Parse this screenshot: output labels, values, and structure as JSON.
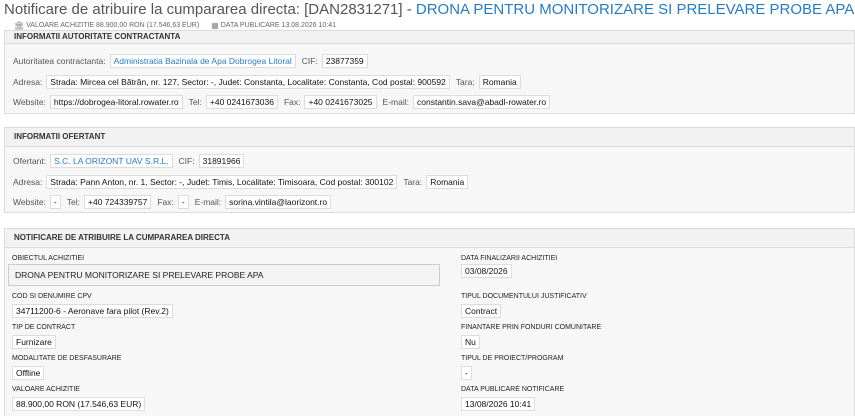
{
  "header": {
    "title_prefix": "Notificare de atribuire la cumpararea directa: [DAN2831271] - ",
    "title_link": "DRONA PENTRU MONITORIZARE SI PRELEVARE PROBE APA",
    "value_text": "VALOARE ACHIZITIE 88.900,00 RON (17.546,63 EUR)",
    "publish_text": "DATA PUBLICARE 13.08.2026 10:41",
    "value_icon": "bank-icon",
    "publish_icon": "calendar-icon"
  },
  "authority": {
    "heading": "INFORMATII AUTORITATE CONTRACTANTA",
    "name_label": "Autoritatea contractanta:",
    "name": "Administratia Bazinala de Apa Dobrogea Litoral",
    "cif_label": "CIF:",
    "cif": "23877359",
    "address_label": "Adresa:",
    "address": "Strada: Mircea cel Bătrân, nr. 127, Sector: -, Judet: Constanta, Localitate: Constanta, Cod postal: 900592",
    "country_label": "Tara:",
    "country": "Romania",
    "website_label": "Website:",
    "website": "https://dobrogea-litoral.rowater.ro",
    "tel_label": "Tel:",
    "tel": "+40 0241673036",
    "fax_label": "Fax:",
    "fax": "+40 0241673025",
    "email_label": "E-mail:",
    "email": "constantin.sava@abadl-rowater.ro"
  },
  "bidder": {
    "heading": "INFORMATII OFERTANT",
    "name_label": "Ofertant:",
    "name": "S.C. LA ORIZONT UAV S.R.L.",
    "cif_label": "CIF:",
    "cif": "31891966",
    "address_label": "Adresa:",
    "address": "Strada: Pann Anton, nr. 1, Sector: -, Judet: Timis, Localitate: Timisoara, Cod postal: 300102",
    "country_label": "Tara:",
    "country": "Romania",
    "website_label": "Website:",
    "website": "-",
    "tel_label": "Tel:",
    "tel": "+40 724339757",
    "fax_label": "Fax:",
    "fax": "-",
    "email_label": "E-mail:",
    "email": "sorina.vintila@laorizont.ro"
  },
  "notice": {
    "heading": "NOTIFICARE DE ATRIBUIRE LA CUMPARAREA DIRECTA",
    "object_label": "OBIECTUL ACHIZITIEI",
    "object": "DRONA PENTRU MONITORIZARE SI PRELEVARE PROBE APA",
    "end_date_label": "DATA FINALIZARII ACHIZITIEI",
    "end_date": "03/08/2026",
    "cpv_label": "COD SI DENUMIRE CPV",
    "cpv": "34711200-6 - Aeronave fara pilot (Rev.2)",
    "doc_type_label": "TIPUL DOCUMENTULUI JUSTIFICATIV",
    "doc_type": "Contract",
    "contract_type_label": "TIP DE CONTRACT",
    "contract_type": "Furnizare",
    "eu_funds_label": "FINANTARE PRIN FONDURI COMUNITARE",
    "eu_funds": "Nu",
    "mode_label": "MODALITATE DE DESFASURARE",
    "mode": "Offline",
    "project_type_label": "TIPUL DE PROIECT/PROGRAM",
    "project_type": "-",
    "value_label": "VALOARE ACHIZITIE",
    "value": "88.900,00 RON (17.546,63 EUR)",
    "publish_label": "DATA PUBLICARE NOTIFICARE",
    "publish": "13/08/2026 10:41"
  }
}
